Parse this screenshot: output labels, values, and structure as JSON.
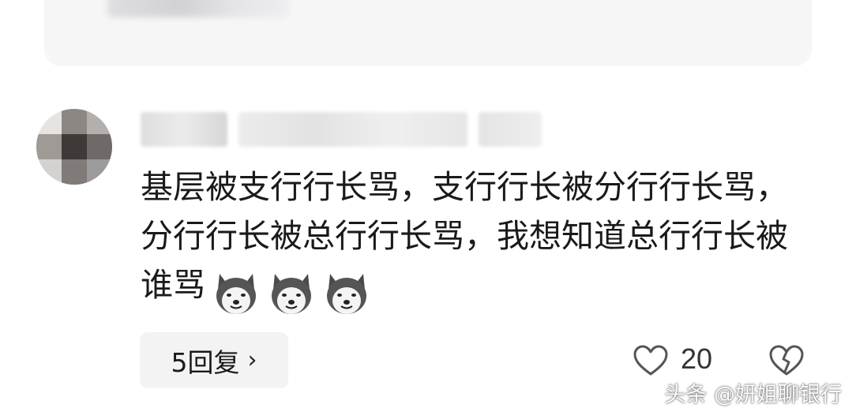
{
  "comment": {
    "text": "基层被支行行长骂，支行行长被分行行长骂，分行行长被总行行长骂，我想知道总行行长被谁骂",
    "emoji": "husky-dog-emoji",
    "emoji_count": 3
  },
  "reply_button": {
    "label": "5回复"
  },
  "likes": {
    "count": "20"
  },
  "watermark": {
    "text": "头条 @妍姐聊银行"
  },
  "colors": {
    "text": "#1a1a1a",
    "card_bg": "#f6f6f7",
    "button_bg": "#f3f3f4",
    "icon_stroke": "#555555"
  }
}
